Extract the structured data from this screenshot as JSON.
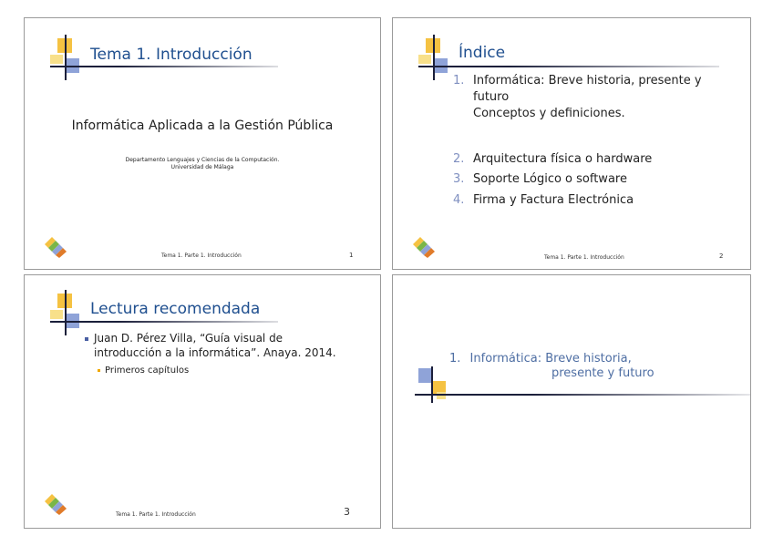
{
  "slides": [
    {
      "title": "Tema 1. Introducción",
      "main": "Informática Aplicada a la Gestión Pública",
      "dept_line1": "Departamento Lenguajes y Ciencias de la Computación.",
      "dept_line2": "Universidad de Málaga",
      "footer": "Tema 1. Parte 1. Introducción",
      "page": "1"
    },
    {
      "title": "Índice",
      "items": [
        {
          "num": "1.",
          "line1": "Informática: Breve historia, presente y",
          "line2": "futuro",
          "line3": "Conceptos y definiciones."
        },
        {
          "num": "2.",
          "line1": "Arquitectura física o hardware"
        },
        {
          "num": "3.",
          "line1": "Soporte Lógico o software"
        },
        {
          "num": "4.",
          "line1": "Firma y Factura Electrónica"
        }
      ],
      "footer": "Tema 1. Parte 1. Introducción",
      "page": "2"
    },
    {
      "title": "Lectura recomendada",
      "bullet_line1": "Juan D. Pérez Villa, “Guía visual de",
      "bullet_line2": "introducción a la informática”. Anaya. 2014.",
      "sub_bullet": "Primeros capítulos",
      "footer": "Tema 1. Parte 1. Introducción",
      "page": "3"
    },
    {
      "section_num": "1.",
      "section_line1": "Informática: Breve historia,",
      "section_line2": "presente y futuro"
    }
  ],
  "colors": {
    "title": "#1f4f8f",
    "accent_yellow": "#f5c242",
    "accent_blue": "#8fa3d8",
    "number": "#7f8fc0"
  },
  "icons": [
    "title-decoration-icon",
    "logo-icon"
  ]
}
